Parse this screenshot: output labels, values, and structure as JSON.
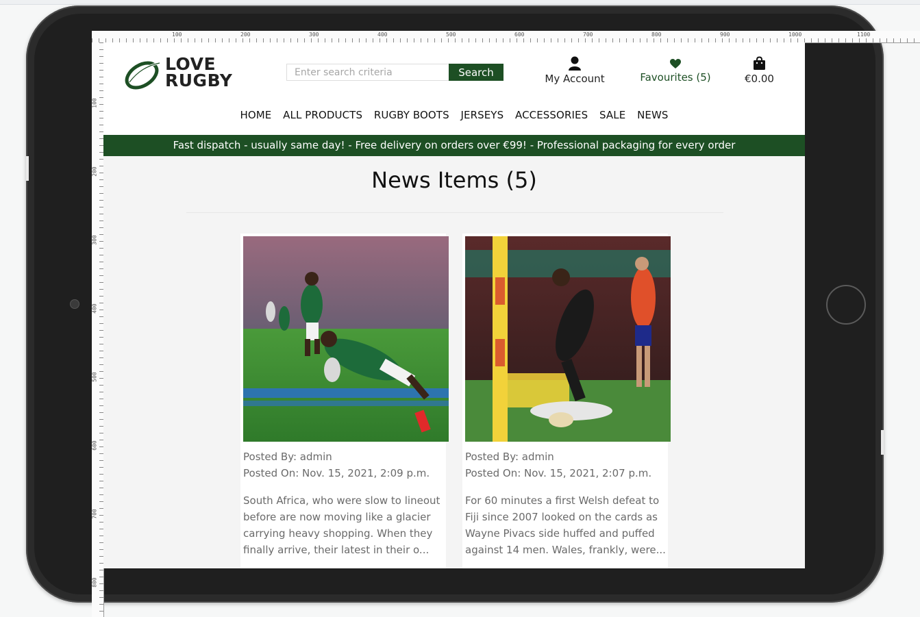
{
  "brand": {
    "line1": "LOVE",
    "line2": "RUGBY"
  },
  "search": {
    "placeholder": "Enter search criteria",
    "button_label": "Search"
  },
  "header_links": {
    "account": "My Account",
    "favourites": "Favourites (5)",
    "basket": "€0.00"
  },
  "nav": [
    "HOME",
    "ALL PRODUCTS",
    "RUGBY BOOTS",
    "JERSEYS",
    "ACCESSORIES",
    "SALE",
    "NEWS"
  ],
  "banner": "Fast dispatch - usually same day! - Free delivery on orders over €99! - Professional packaging for every order",
  "page_title": "News Items (5)",
  "news": [
    {
      "posted_by": "Posted By: admin",
      "posted_on": "Posted On: Nov. 15, 2021, 2:09 p.m.",
      "excerpt": "South Africa, who were slow to lineout before are now moving like a glacier carrying heavy shopping. When they finally arrive, their latest in their o..."
    },
    {
      "posted_by": "Posted By: admin",
      "posted_on": "Posted On: Nov. 15, 2021, 2:07 p.m.",
      "excerpt": "For 60 minutes a first Welsh defeat to Fiji since 2007 looked on the cards as Wayne Pivacs side huffed and puffed against 14 men. Wales, frankly, were..."
    }
  ],
  "ruler": {
    "top": [
      "100",
      "200",
      "300",
      "400",
      "500",
      "600",
      "700",
      "800",
      "900",
      "1000",
      "1100"
    ],
    "left": [
      "100",
      "200",
      "300",
      "400",
      "500",
      "600",
      "700",
      "800"
    ]
  },
  "colors": {
    "brand_green": "#1d4f24",
    "text": "#111111",
    "muted": "#6a6a6a"
  },
  "icons": {
    "account": "user-icon",
    "favourites": "heart-icon",
    "basket": "shopping-bag-icon"
  }
}
